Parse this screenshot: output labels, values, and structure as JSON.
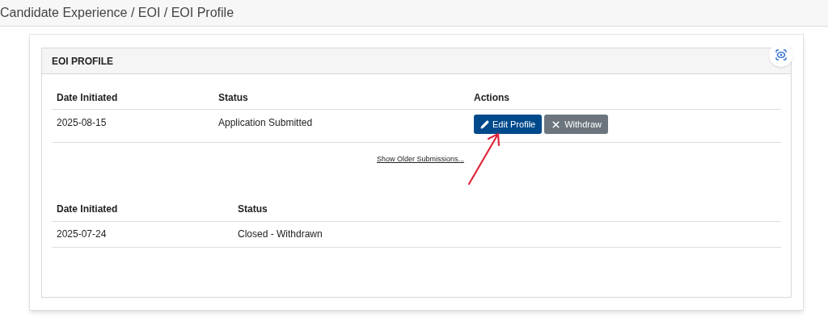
{
  "breadcrumb": "Candidate Experience / EOI / EOI Profile",
  "panel": {
    "title": "EOI PROFILE"
  },
  "current_table": {
    "columns": [
      "Date Initiated",
      "Status",
      "Actions"
    ],
    "rows": [
      {
        "date": "2025-08-15",
        "status": "Application Submitted",
        "actions": [
          {
            "kind": "edit",
            "label": "Edit Profile"
          },
          {
            "kind": "withdraw",
            "label": "Withdraw"
          }
        ]
      }
    ]
  },
  "show_older_link": "Show Older Submissions...",
  "older_table": {
    "columns": [
      "Date Initiated",
      "Status"
    ],
    "rows": [
      {
        "date": "2025-07-24",
        "status": "Closed - Withdrawn"
      }
    ]
  }
}
